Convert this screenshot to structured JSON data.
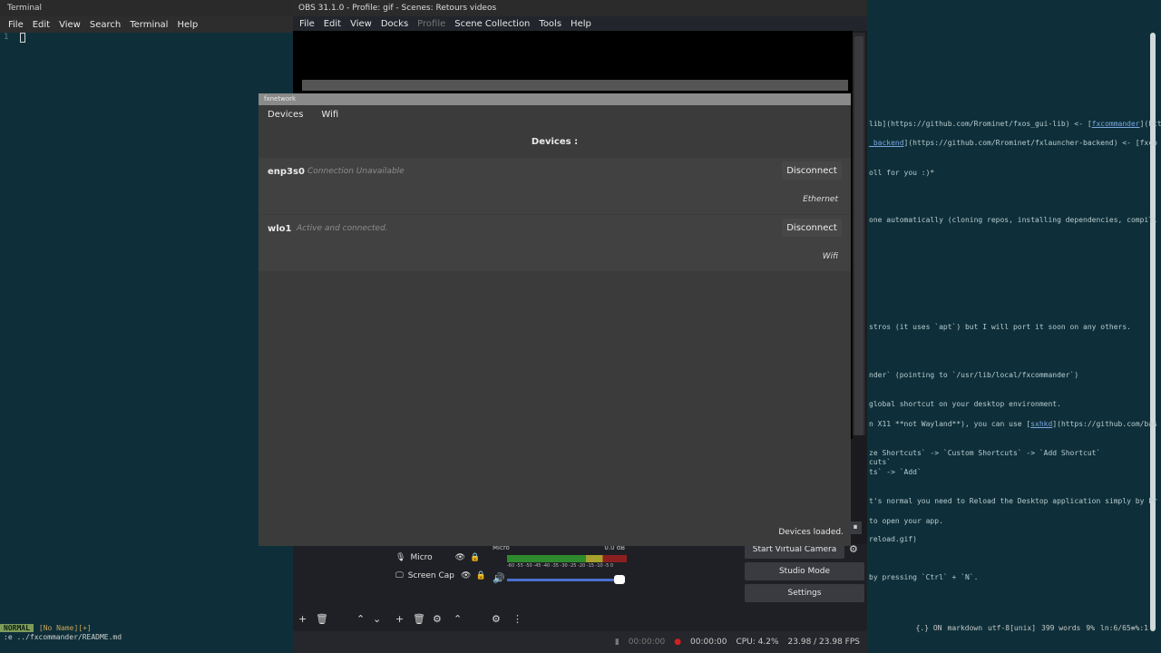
{
  "terminal": {
    "title": "Terminal",
    "menu": [
      "File",
      "Edit",
      "View",
      "Search",
      "Terminal",
      "Help"
    ],
    "line_number": "1",
    "mode": "NORMAL",
    "buffer": "[No Name][+]",
    "cmdline": ":e ../fxcommander/README.md"
  },
  "right_terminal": {
    "lines": [
      {
        "pre": "lib](https://github.com/Rrominet/fxos_gui-lib) <- [",
        "link": "fxcommander",
        "post": "](htt"
      },
      {
        "pre": "",
        "link": "_backend",
        "post": "](https://github.com/Rrominet/fxlauncher-backend) <- [fxco"
      },
      {
        "pre": "oll for you :)*",
        "link": "",
        "post": ""
      },
      {
        "pre": "one automatically (cloning repos, installing dependencies, compili",
        "link": "",
        "post": ""
      },
      {
        "pre": "stros (it uses `apt`) but I will port it soon on any others.",
        "link": "",
        "post": ""
      },
      {
        "pre": "nder` (pointing to `/usr/lib/local/fxcommander`)",
        "link": "",
        "post": ""
      },
      {
        "pre": "global shortcut on your desktop environment.",
        "link": "",
        "post": ""
      },
      {
        "pre": "n X11 **not Wayland**), you can use [",
        "link": "sxhkd",
        "post": "](https://github.com/bas"
      },
      {
        "pre": "ze Shortcuts` -> `Custom Shortcuts` -> `Add Shortcut`",
        "link": "",
        "post": ""
      },
      {
        "pre": "cuts`",
        "link": "",
        "post": ""
      },
      {
        "pre": "ts` -> `Add`",
        "link": "",
        "post": ""
      },
      {
        "pre": "t's normal you need to Reload the Desktop application simply by Pr",
        "link": "",
        "post": ""
      },
      {
        "pre": "to open your app.",
        "link": "",
        "post": ""
      },
      {
        "pre": "reload.gif)",
        "link": "",
        "post": ""
      },
      {
        "pre": "by pressing `Ctrl` + `N`.",
        "link": "",
        "post": ""
      }
    ],
    "status": [
      "{.} ON",
      "markdown",
      "utf-8[unix]",
      "399 words",
      "9%",
      "ln:6/65≡%:1"
    ]
  },
  "obs": {
    "title": "OBS 31.1.0 - Profile: gif - Scenes: Retours videos",
    "menu": [
      {
        "label": "File",
        "enabled": true
      },
      {
        "label": "Edit",
        "enabled": true
      },
      {
        "label": "View",
        "enabled": true
      },
      {
        "label": "Docks",
        "enabled": true
      },
      {
        "label": "Profile",
        "enabled": false
      },
      {
        "label": "Scene Collection",
        "enabled": true
      },
      {
        "label": "Tools",
        "enabled": true
      },
      {
        "label": "Help",
        "enabled": true
      }
    ],
    "sources": [
      {
        "label": "Micro",
        "icon": "microphone-icon"
      },
      {
        "label": "Screen Cap",
        "icon": "monitor-icon"
      }
    ],
    "mixer": {
      "channel": "Micro",
      "level": "0.0 dB",
      "scale": "-60 -55 -50 -45 -40 -35 -30 -25 -20 -15 -10 -5 0"
    },
    "controls": [
      "Start Virtual Camera",
      "Studio Mode",
      "Settings"
    ],
    "status": {
      "rec_off": "00:00:00",
      "rec": "00:00:00",
      "cpu": "CPU: 4.2%",
      "fps": "23.98 / 23.98 FPS"
    }
  },
  "fxnetwork": {
    "title": "fxnetwork",
    "tabs": [
      "Devices",
      "Wifi"
    ],
    "heading": "Devices :",
    "devices": [
      {
        "name": "enp3s0",
        "state": "Connection Unavailable",
        "button": "Disconnect",
        "type": "Ethernet"
      },
      {
        "name": "wlo1",
        "state": "Active and connected.",
        "button": "Disconnect",
        "type": "Wifi"
      }
    ],
    "footer": "Devices loaded."
  }
}
